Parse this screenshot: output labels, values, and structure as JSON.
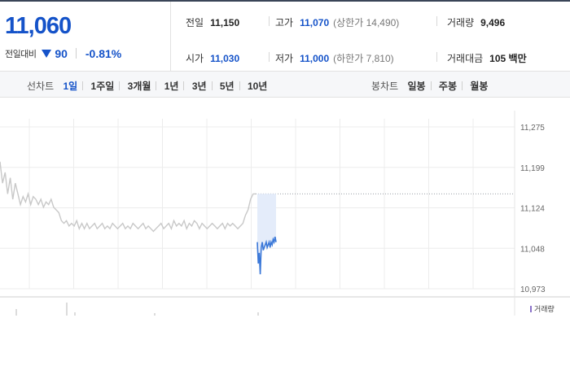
{
  "summary": {
    "price": "11,060",
    "change_label": "전일대비",
    "change_amount": "90",
    "change_rate": "-0.81%",
    "prev_close_label": "전일",
    "prev_close": "11,150",
    "high_label": "고가",
    "high": "11,070",
    "upper_limit": "(상한가 14,490)",
    "volume_label": "거래량",
    "volume": "9,496",
    "open_label": "시가",
    "open": "11,030",
    "low_label": "저가",
    "low": "11,000",
    "lower_limit": "(하한가 7,810)",
    "value_label": "거래대금",
    "value": "105 백만"
  },
  "periods": {
    "line_label": "선차트",
    "line_items": [
      "1일",
      "1주일",
      "3개월",
      "1년",
      "3년",
      "5년",
      "10년"
    ],
    "active_index": 0,
    "candle_label": "봉차트",
    "candle_items": [
      "일봉",
      "주봉",
      "월봉"
    ]
  },
  "colors": {
    "accent": "#1553c9",
    "down": "#1553c9",
    "prev_line": "#c8c8c8",
    "today_line": "#3b78d8",
    "today_fill": "#e4ecfa"
  },
  "chart_data": {
    "type": "line",
    "title": "",
    "y_ticks": [
      "11,275",
      "11,199",
      "11,124",
      "11,048",
      "10,973"
    ],
    "ylim": [
      10973,
      11275
    ],
    "reference_line": 11150,
    "volume_legend": "거래량",
    "grid": true,
    "series": [
      {
        "x": [
          0,
          1,
          2,
          3,
          4,
          5,
          6,
          7,
          8,
          9,
          10,
          11,
          12,
          13,
          14,
          15,
          16,
          17,
          18,
          19,
          20,
          21,
          22,
          23,
          24,
          25,
          26,
          27,
          28,
          29,
          30,
          31,
          32,
          33,
          34,
          35,
          36,
          37,
          38,
          39,
          40,
          41,
          42,
          43,
          44,
          45,
          46,
          47,
          48,
          49,
          50,
          51,
          52,
          53,
          54,
          55,
          56,
          57,
          58,
          59,
          60,
          61,
          62,
          63,
          64,
          65,
          66,
          67,
          68,
          69,
          70,
          71,
          72,
          73,
          74,
          75,
          76,
          77,
          78,
          79,
          80,
          81,
          82,
          83,
          84,
          85,
          86,
          87,
          88,
          89,
          90,
          91,
          92,
          93,
          94,
          95,
          96,
          97,
          98,
          99,
          100
        ],
        "values": [
          11210,
          11170,
          11190,
          11150,
          11180,
          11140,
          11170,
          11150,
          11130,
          11145,
          11135,
          11150,
          11130,
          11145,
          11140,
          11130,
          11140,
          11125,
          11135,
          11130,
          11140,
          11125,
          11120,
          11115,
          11100,
          11095,
          11100,
          11090,
          11095,
          11090,
          11100,
          11085,
          11095,
          11085,
          11095,
          11085,
          11090,
          11095,
          11085,
          11090,
          11095,
          11085,
          11090,
          11085,
          11095,
          11090,
          11085,
          11090,
          11095,
          11085,
          11090,
          11085,
          11095,
          11090,
          11085,
          11090,
          11095,
          11085,
          11090,
          11085,
          11080,
          11085,
          11090,
          11095,
          11085,
          11090,
          11095,
          11085,
          11100,
          11090,
          11095,
          11090,
          11100,
          11085,
          11095,
          11090,
          11100,
          11095,
          11085,
          11095,
          11090,
          11085,
          11090,
          11095,
          11090,
          11085,
          11090,
          11095,
          11085,
          11095,
          11090,
          11095,
          11090,
          11085,
          11090,
          11095,
          11110,
          11120,
          11140,
          11150,
          11150
        ]
      },
      {
        "x": [
          0,
          1,
          2,
          3,
          4,
          5,
          6,
          7,
          8,
          9,
          10,
          11,
          12,
          13,
          14,
          15,
          16,
          17,
          18,
          19
        ],
        "values": [
          11060,
          11020,
          11040,
          11000,
          11050,
          11060,
          11045,
          11050,
          11055,
          11060,
          11050,
          11055,
          11060,
          11050,
          11060,
          11055,
          11065,
          11060,
          11070,
          11060
        ]
      }
    ]
  }
}
